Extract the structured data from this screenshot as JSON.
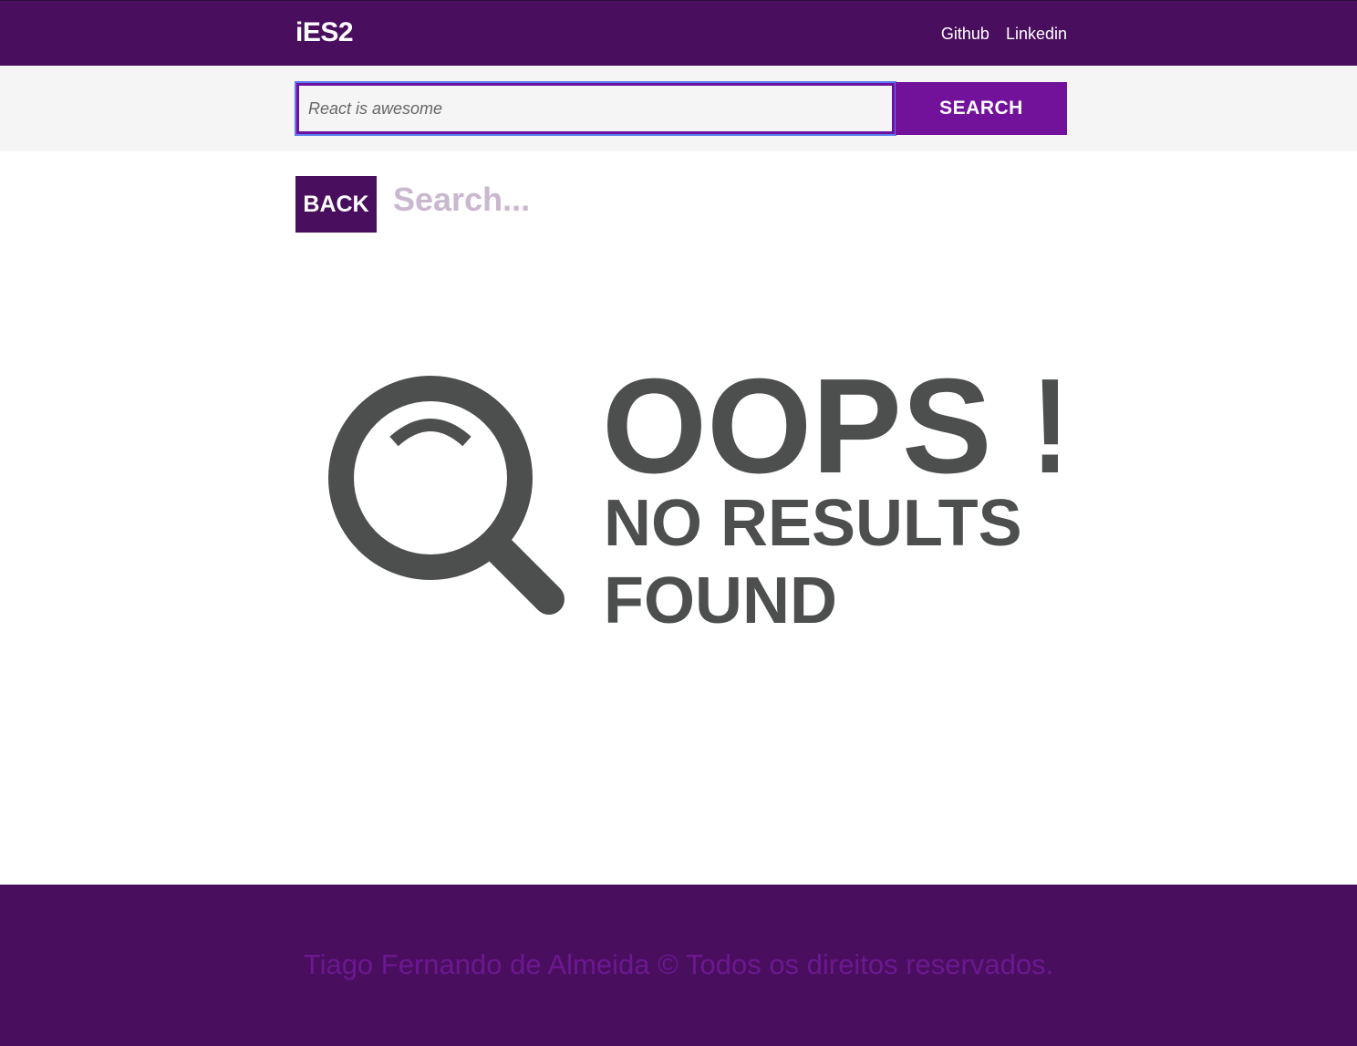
{
  "header": {
    "logo": "iES2",
    "nav": [
      {
        "label": "Github"
      },
      {
        "label": "Linkedin"
      }
    ]
  },
  "search": {
    "placeholder": "React is awesome",
    "value": "",
    "button_label": "SEARCH"
  },
  "results": {
    "back_label": "BACK",
    "heading": "Search...",
    "empty_state": {
      "line1": "OOPS !",
      "line2": "NO RESULTS",
      "line3": "FOUND",
      "icon": "magnifier-icon"
    }
  },
  "footer": {
    "text": "Tiago Fernando de Almeida © Todos os direitos reservados."
  },
  "colors": {
    "brand": "#4a0e5e",
    "accent": "#72129b",
    "illustration": "#4d4f4e"
  }
}
